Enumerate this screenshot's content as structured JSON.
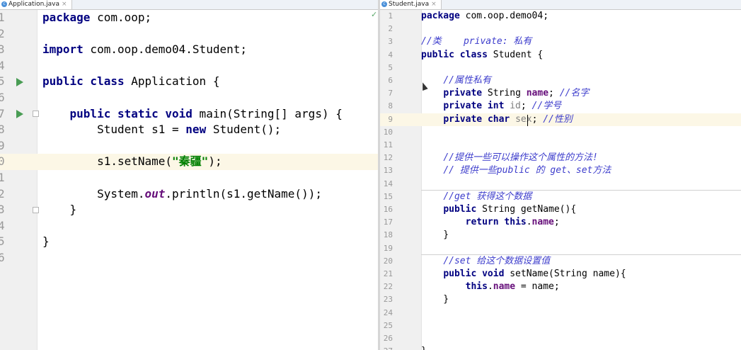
{
  "left_editor": {
    "tab": {
      "icon": "java-class-icon",
      "label": "Application.java",
      "close": "×"
    },
    "status_icon": "✓",
    "current_line": 10,
    "lines": [
      {
        "n": "1",
        "tokens": [
          {
            "t": "package",
            "c": "kw"
          },
          {
            "t": " com.oop;"
          }
        ]
      },
      {
        "n": "2",
        "tokens": []
      },
      {
        "n": "3",
        "tokens": [
          {
            "t": "import",
            "c": "kw"
          },
          {
            "t": " com.oop.demo04.Student;"
          }
        ]
      },
      {
        "n": "4",
        "tokens": []
      },
      {
        "n": "5",
        "run": true,
        "tokens": [
          {
            "t": "public class",
            "c": "kw"
          },
          {
            "t": " Application {"
          }
        ]
      },
      {
        "n": "6",
        "tokens": []
      },
      {
        "n": "7",
        "run": true,
        "fold": true,
        "tokens": [
          {
            "t": "    "
          },
          {
            "t": "public static void",
            "c": "kw"
          },
          {
            "t": " main(String[] args) {"
          }
        ]
      },
      {
        "n": "8",
        "tokens": [
          {
            "t": "        Student s1 = "
          },
          {
            "t": "new",
            "c": "kw"
          },
          {
            "t": " Student();"
          }
        ]
      },
      {
        "n": "9",
        "tokens": []
      },
      {
        "n": "0",
        "tokens": [
          {
            "t": "        s1.setName("
          },
          {
            "t": "\"秦疆\"",
            "c": "str"
          },
          {
            "t": ");"
          }
        ]
      },
      {
        "n": "1",
        "tokens": []
      },
      {
        "n": "2",
        "tokens": [
          {
            "t": "        System."
          },
          {
            "t": "out",
            "c": "static-field"
          },
          {
            "t": ".println(s1.getName());"
          }
        ]
      },
      {
        "n": "3",
        "fold": true,
        "tokens": [
          {
            "t": "    }"
          }
        ]
      },
      {
        "n": "4",
        "tokens": []
      },
      {
        "n": "5",
        "tokens": [
          {
            "t": "}"
          }
        ]
      },
      {
        "n": "6",
        "tokens": []
      }
    ]
  },
  "right_editor": {
    "tab": {
      "icon": "java-class-icon",
      "label": "Student.java",
      "close": "×"
    },
    "current_line": 9,
    "lines": [
      {
        "n": "1",
        "tokens": [
          {
            "t": "package",
            "c": "kw"
          },
          {
            "t": " com.oop.demo04;"
          }
        ]
      },
      {
        "n": "2",
        "tokens": []
      },
      {
        "n": "3",
        "tokens": [
          {
            "t": "//类    private: 私有",
            "c": "cmt"
          }
        ]
      },
      {
        "n": "4",
        "tokens": [
          {
            "t": "public class",
            "c": "kw"
          },
          {
            "t": " Student {"
          }
        ]
      },
      {
        "n": "5",
        "tokens": []
      },
      {
        "n": "6",
        "tokens": [
          {
            "t": "    "
          },
          {
            "t": "//属性私有",
            "c": "cmt"
          }
        ]
      },
      {
        "n": "7",
        "tokens": [
          {
            "t": "    "
          },
          {
            "t": "private",
            "c": "kw"
          },
          {
            "t": " String "
          },
          {
            "t": "name",
            "c": "field"
          },
          {
            "t": "; "
          },
          {
            "t": "//名字",
            "c": "cmt"
          }
        ]
      },
      {
        "n": "8",
        "tokens": [
          {
            "t": "    "
          },
          {
            "t": "private int",
            "c": "kw"
          },
          {
            "t": " "
          },
          {
            "t": "id",
            "c": "unused"
          },
          {
            "t": "; "
          },
          {
            "t": "//学号",
            "c": "cmt"
          }
        ]
      },
      {
        "n": "9",
        "tokens": [
          {
            "t": "    "
          },
          {
            "t": "private",
            "c": "kw"
          },
          {
            "t": " "
          },
          {
            "t": "char",
            "c": "kw"
          },
          {
            "t": " "
          },
          {
            "t": "sex",
            "c": "unused"
          },
          {
            "t": "; "
          },
          {
            "t": "//性别",
            "c": "cmt"
          }
        ]
      },
      {
        "n": "10",
        "tokens": []
      },
      {
        "n": "11",
        "tokens": []
      },
      {
        "n": "12",
        "tokens": [
          {
            "t": "    "
          },
          {
            "t": "//提供一些可以操作这个属性的方法!",
            "c": "cmt"
          }
        ]
      },
      {
        "n": "13",
        "tokens": [
          {
            "t": "    "
          },
          {
            "t": "// 提供一些public 的 get、set方法",
            "c": "cmt"
          }
        ]
      },
      {
        "n": "14",
        "tokens": []
      },
      {
        "n": "15",
        "tokens": [
          {
            "t": "    "
          },
          {
            "t": "//get 获得这个数据",
            "c": "cmt"
          }
        ]
      },
      {
        "n": "16",
        "tokens": [
          {
            "t": "    "
          },
          {
            "t": "public",
            "c": "kw"
          },
          {
            "t": " String getName(){"
          }
        ]
      },
      {
        "n": "17",
        "tokens": [
          {
            "t": "        "
          },
          {
            "t": "return this",
            "c": "kw"
          },
          {
            "t": "."
          },
          {
            "t": "name",
            "c": "field"
          },
          {
            "t": ";"
          }
        ]
      },
      {
        "n": "18",
        "tokens": [
          {
            "t": "    }"
          }
        ]
      },
      {
        "n": "19",
        "tokens": []
      },
      {
        "n": "20",
        "tokens": [
          {
            "t": "    "
          },
          {
            "t": "//set 给这个数据设置值",
            "c": "cmt"
          }
        ]
      },
      {
        "n": "21",
        "tokens": [
          {
            "t": "    "
          },
          {
            "t": "public void",
            "c": "kw"
          },
          {
            "t": " setName(String name){"
          }
        ]
      },
      {
        "n": "22",
        "tokens": [
          {
            "t": "        "
          },
          {
            "t": "this",
            "c": "kw"
          },
          {
            "t": "."
          },
          {
            "t": "name",
            "c": "field"
          },
          {
            "t": " = name;"
          }
        ]
      },
      {
        "n": "23",
        "tokens": [
          {
            "t": "    }"
          }
        ]
      },
      {
        "n": "24",
        "tokens": []
      },
      {
        "n": "25",
        "tokens": []
      },
      {
        "n": "26",
        "tokens": []
      },
      {
        "n": "27",
        "tokens": [
          {
            "t": "}"
          }
        ]
      }
    ]
  }
}
